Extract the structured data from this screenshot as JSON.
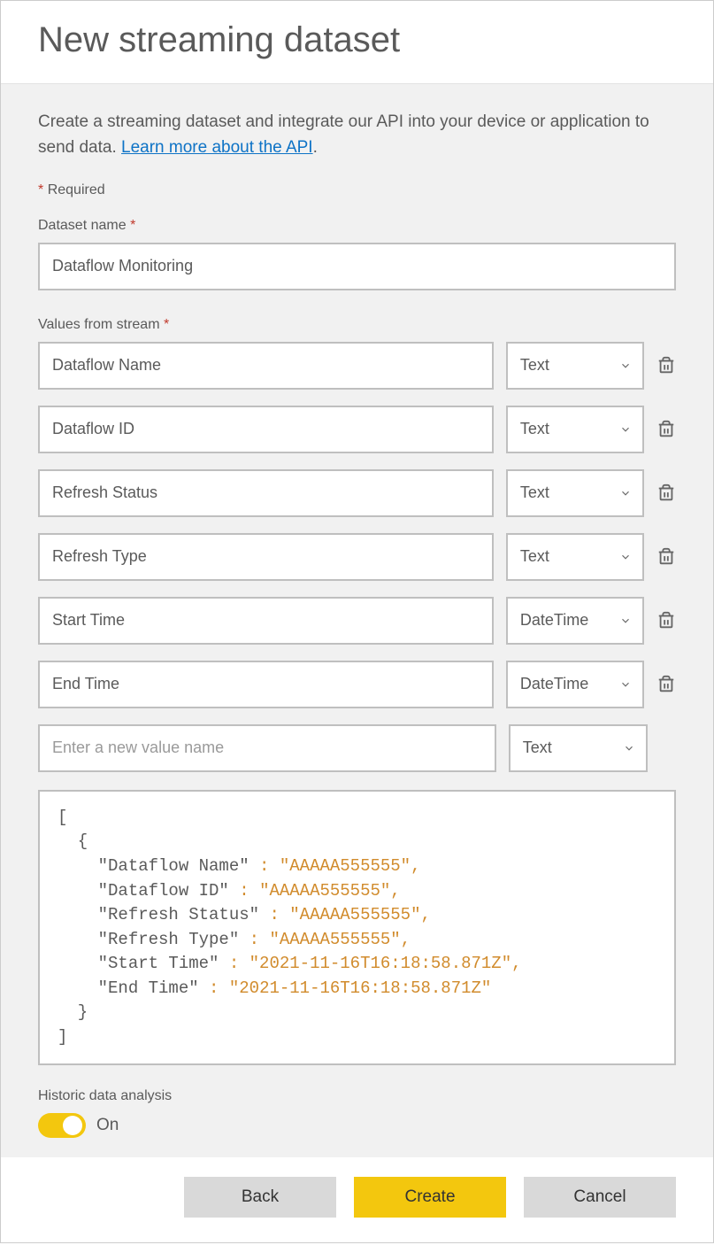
{
  "header": {
    "title": "New streaming dataset"
  },
  "description": {
    "text_before": "Create a streaming dataset and integrate our API into your device or application to send data. ",
    "link_text": "Learn more about the API",
    "text_after": "."
  },
  "required_note": "Required",
  "dataset_name": {
    "label": "Dataset name",
    "value": "Dataflow Monitoring"
  },
  "values_from_stream": {
    "label": "Values from stream",
    "rows": [
      {
        "name": "Dataflow Name",
        "type": "Text"
      },
      {
        "name": "Dataflow ID",
        "type": "Text"
      },
      {
        "name": "Refresh Status",
        "type": "Text"
      },
      {
        "name": "Refresh Type",
        "type": "Text"
      },
      {
        "name": "Start Time",
        "type": "DateTime"
      },
      {
        "name": "End Time",
        "type": "DateTime"
      }
    ],
    "new_row": {
      "placeholder": "Enter a new value name",
      "type": "Text"
    }
  },
  "json_preview": {
    "entries": [
      {
        "key": "Dataflow Name",
        "value": "AAAAA555555"
      },
      {
        "key": "Dataflow ID",
        "value": "AAAAA555555"
      },
      {
        "key": "Refresh Status",
        "value": "AAAAA555555"
      },
      {
        "key": "Refresh Type",
        "value": "AAAAA555555"
      },
      {
        "key": "Start Time",
        "value": "2021-11-16T16:18:58.871Z"
      },
      {
        "key": "End Time",
        "value": "2021-11-16T16:18:58.871Z"
      }
    ]
  },
  "historic": {
    "label": "Historic data analysis",
    "state_label": "On",
    "value": true
  },
  "footer": {
    "back": "Back",
    "create": "Create",
    "cancel": "Cancel"
  }
}
